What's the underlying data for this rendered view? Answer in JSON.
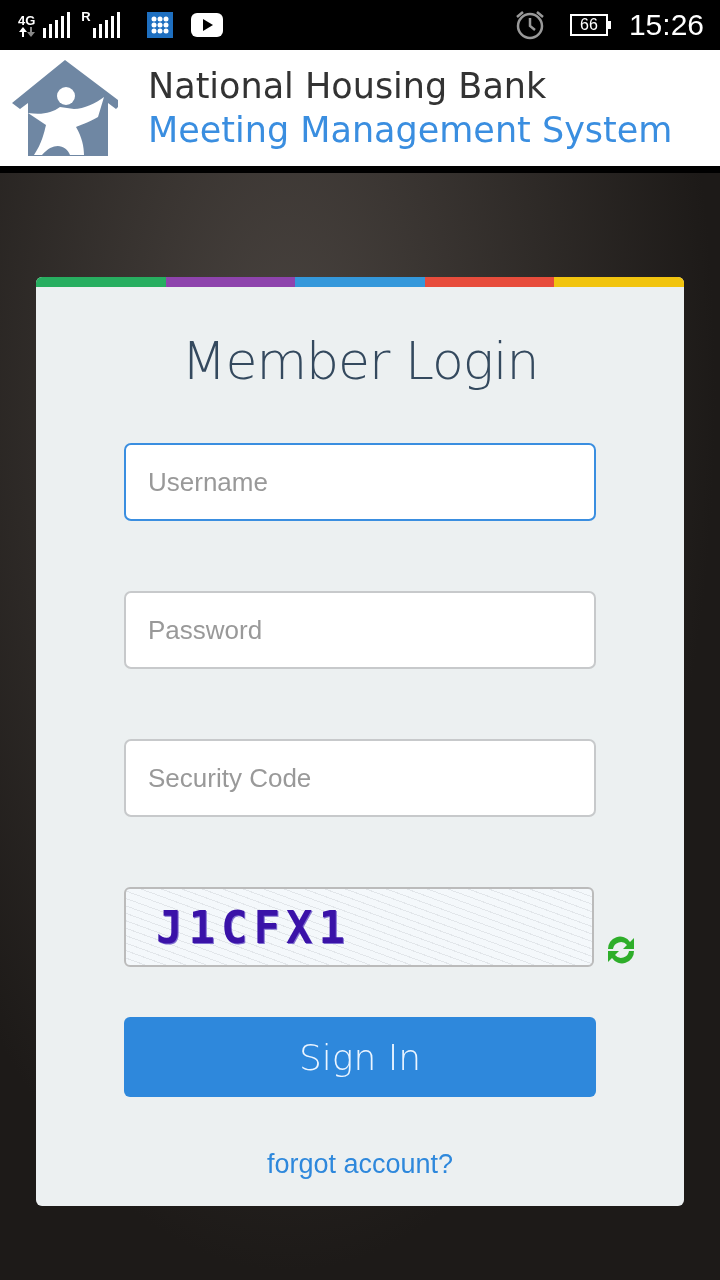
{
  "status_bar": {
    "network": "4G",
    "roaming": "R",
    "battery": "66",
    "time": "15:26"
  },
  "header": {
    "title": "National Housing Bank",
    "subtitle": "Meeting Management System"
  },
  "login_card": {
    "stripe": [
      {
        "color": "#27ae60"
      },
      {
        "color": "#8e44ad"
      },
      {
        "color": "#3498db"
      },
      {
        "color": "#e74c3c"
      },
      {
        "color": "#f1c40f"
      }
    ],
    "title": "Member Login",
    "fields": [
      {
        "placeholder": "Username",
        "focused": true
      },
      {
        "placeholder": "Password",
        "focused": false
      },
      {
        "placeholder": "Security Code",
        "focused": false
      }
    ],
    "captcha_text": "J1CFX1",
    "sign_in_button": "Sign In",
    "forgot_link": "forgot account?"
  }
}
